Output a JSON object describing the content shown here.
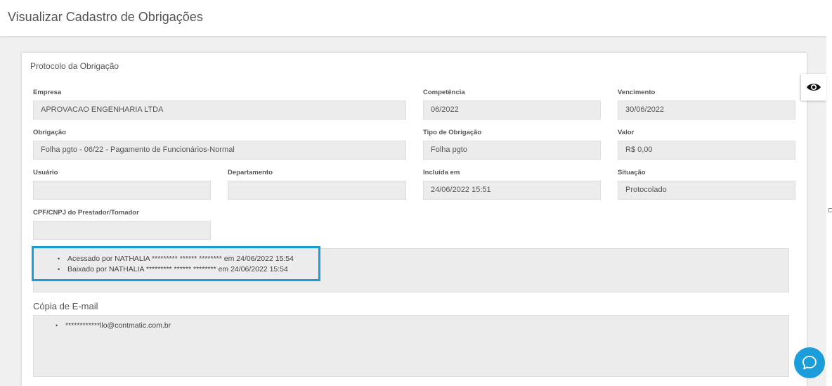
{
  "page": {
    "title": "Visualizar Cadastro de Obrigações"
  },
  "card": {
    "title": "Protocolo da Obrigação",
    "fields": {
      "empresa": {
        "label": "Empresa",
        "value": "APROVACAO ENGENHARIA LTDA"
      },
      "competencia": {
        "label": "Competência",
        "value": "06/2022"
      },
      "vencimento": {
        "label": "Vencimento",
        "value": "30/06/2022"
      },
      "obrigacao": {
        "label": "Obrigação",
        "value": "Folha pgto - 06/22 - Pagamento de Funcionários-Normal"
      },
      "tipo": {
        "label": "Tipo de Obrigação",
        "value": "Folha pgto"
      },
      "valor": {
        "label": "Valor",
        "value": "R$ 0,00"
      },
      "usuario": {
        "label": "Usuário",
        "value": ""
      },
      "departamento": {
        "label": "Departamento",
        "value": ""
      },
      "incluida": {
        "label": "Incluída em",
        "value": "24/06/2022 15:51"
      },
      "situacao": {
        "label": "Situação",
        "value": "Protocolado"
      },
      "cpf": {
        "label": "CPF/CNPJ do Prestador/Tomador",
        "value": ""
      }
    },
    "history": [
      "Acessado por NATHALIA ********* ****** ******** em 24/06/2022 15:54",
      "Baixado por NATHALIA ********* ****** ******** em 24/06/2022 15:54"
    ],
    "email_section": {
      "title": "Cópia de E-mail",
      "emails": [
        "************llo@contmatic.com.br"
      ]
    }
  },
  "colors": {
    "accent": "#1b9ddc",
    "field_bg": "#ececec"
  },
  "icons": {
    "eye": "eye-icon",
    "chat": "chat-icon",
    "bullet": "•"
  }
}
